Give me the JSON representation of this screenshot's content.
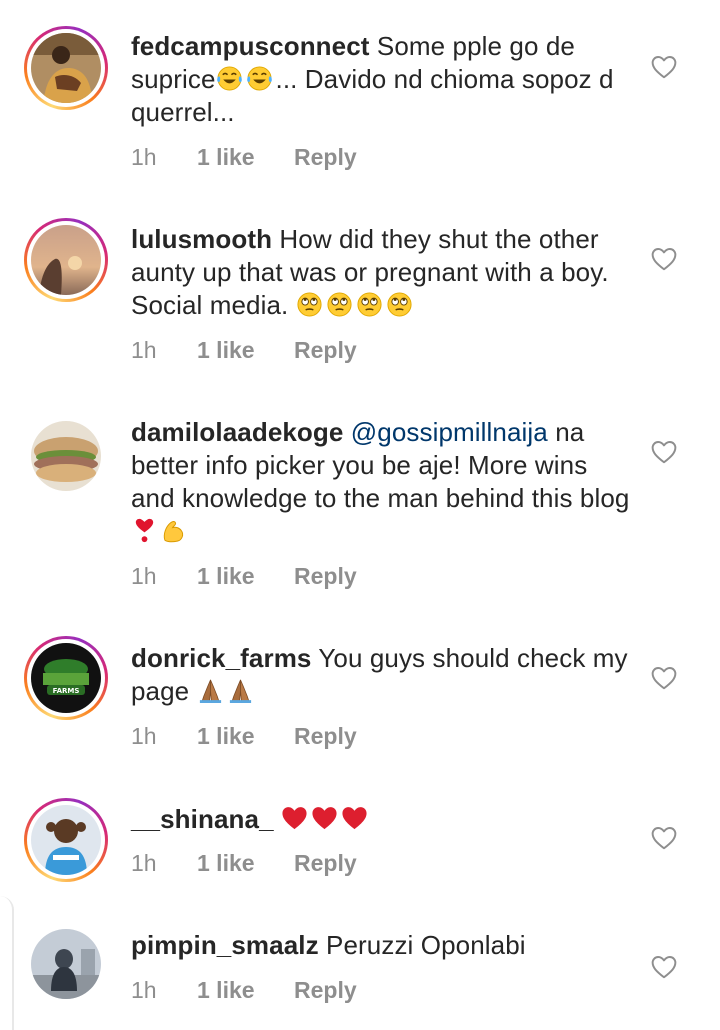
{
  "comments": [
    {
      "username": "fedcampusconnect",
      "text_before": "Some pple go de suprice",
      "emojis_1": [
        "face-with-tears-of-joy",
        "face-with-tears-of-joy"
      ],
      "text_after": "... Davido nd chioma sopoz d querrel...",
      "time": "1h",
      "likes": "1 like",
      "reply": "Reply",
      "story_ring": true
    },
    {
      "username": "lulusmooth",
      "text_before": "How did they shut the other aunty up that was or pregnant with a boy. Social media. ",
      "emojis_1": [
        "face-with-rolling-eyes",
        "face-with-rolling-eyes",
        "face-with-rolling-eyes",
        "face-with-rolling-eyes"
      ],
      "text_after": "",
      "time": "1h",
      "likes": "1 like",
      "reply": "Reply",
      "story_ring": true
    },
    {
      "username": "damilolaadekoge",
      "mention": "@gossipmillnaija",
      "text_before": " na better info picker you be aje! More wins and knowledge to the man behind this blog ",
      "emojis_1": [
        "heavy-heart-exclamation",
        "flexed-biceps"
      ],
      "text_after": "",
      "time": "1h",
      "likes": "1 like",
      "reply": "Reply",
      "story_ring": false
    },
    {
      "username": "donrick_farms",
      "text_before": "You guys should check my page ",
      "emojis_1": [
        "folded-hands",
        "folded-hands"
      ],
      "text_after": "",
      "time": "1h",
      "likes": "1 like",
      "reply": "Reply",
      "story_ring": true,
      "avatar_label": "FARMS"
    },
    {
      "username": "__shinana_",
      "text_before": "",
      "emojis_1": [
        "red-heart",
        "red-heart",
        "red-heart"
      ],
      "text_after": "",
      "time": "1h",
      "likes": "1 like",
      "reply": "Reply",
      "story_ring": true
    },
    {
      "username": "pimpin_smaalz",
      "text_before": "Peruzzi Oponlabi",
      "emojis_1": [],
      "text_after": "",
      "time": "1h",
      "likes": "1 like",
      "reply": "Reply",
      "story_ring": false
    }
  ],
  "colors": {
    "text": "#262626",
    "meta": "#8e8e8e",
    "mention": "#00376b",
    "heart_outline": "#8e8e8e"
  },
  "icons": {
    "like": "heart-outline-icon"
  }
}
